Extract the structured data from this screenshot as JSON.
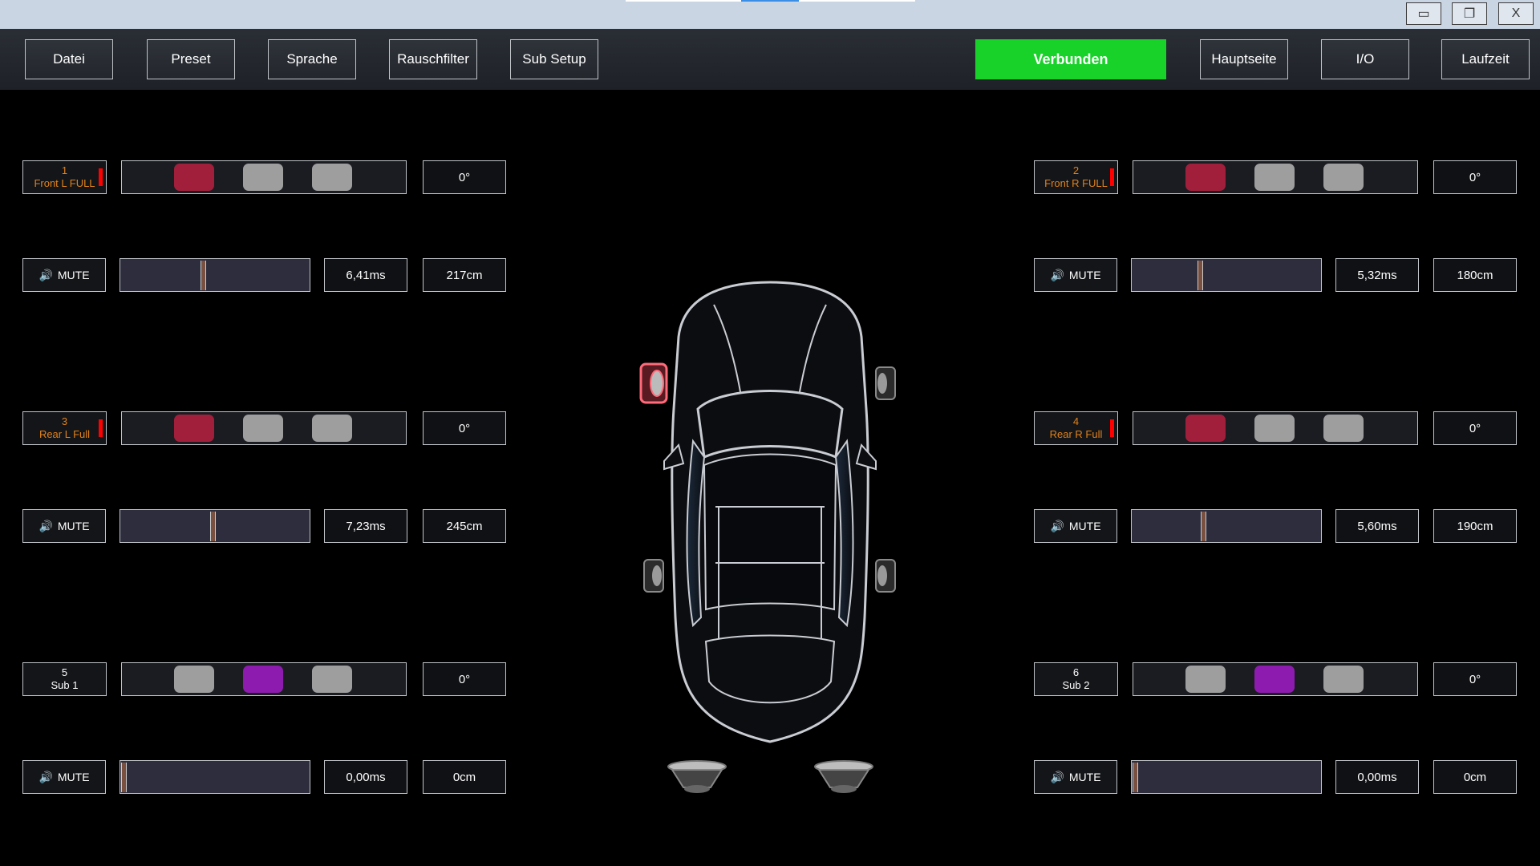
{
  "window": {
    "minimize": "▭",
    "restore": "❐",
    "close": "X"
  },
  "toolbar": {
    "datei": "Datei",
    "preset": "Preset",
    "sprache": "Sprache",
    "rauschfilter": "Rauschfilter",
    "sub_setup": "Sub Setup",
    "status": "Verbunden",
    "hauptseite": "Hauptseite",
    "io": "I/O",
    "laufzeit": "Laufzeit"
  },
  "colors": {
    "status_green": "#18d22a",
    "active_red": "#a11f3a",
    "active_purple": "#8e1bb0",
    "inactive_grey": "#9e9e9e",
    "label_orange": "#e0821b"
  },
  "channels": [
    {
      "num": "1",
      "name": "Front L FULL",
      "phase": "0°",
      "mute": "MUTE",
      "delay": "6,41ms",
      "distance": "217cm",
      "delay_fraction": 0.43
    },
    {
      "num": "2",
      "name": "Front R FULL",
      "phase": "0°",
      "mute": "MUTE",
      "delay": "5,32ms",
      "distance": "180cm",
      "delay_fraction": 0.36
    },
    {
      "num": "3",
      "name": "Rear L Full",
      "phase": "0°",
      "mute": "MUTE",
      "delay": "7,23ms",
      "distance": "245cm",
      "delay_fraction": 0.48
    },
    {
      "num": "4",
      "name": "Rear R Full",
      "phase": "0°",
      "mute": "MUTE",
      "delay": "5,60ms",
      "distance": "190cm",
      "delay_fraction": 0.37
    },
    {
      "num": "5",
      "name": "Sub 1",
      "phase": "0°",
      "mute": "MUTE",
      "delay": "0,00ms",
      "distance": "0cm",
      "delay_fraction": 0.0
    },
    {
      "num": "6",
      "name": "Sub 2",
      "phase": "0°",
      "mute": "MUTE",
      "delay": "0,00ms",
      "distance": "0cm",
      "delay_fraction": 0.0
    }
  ]
}
